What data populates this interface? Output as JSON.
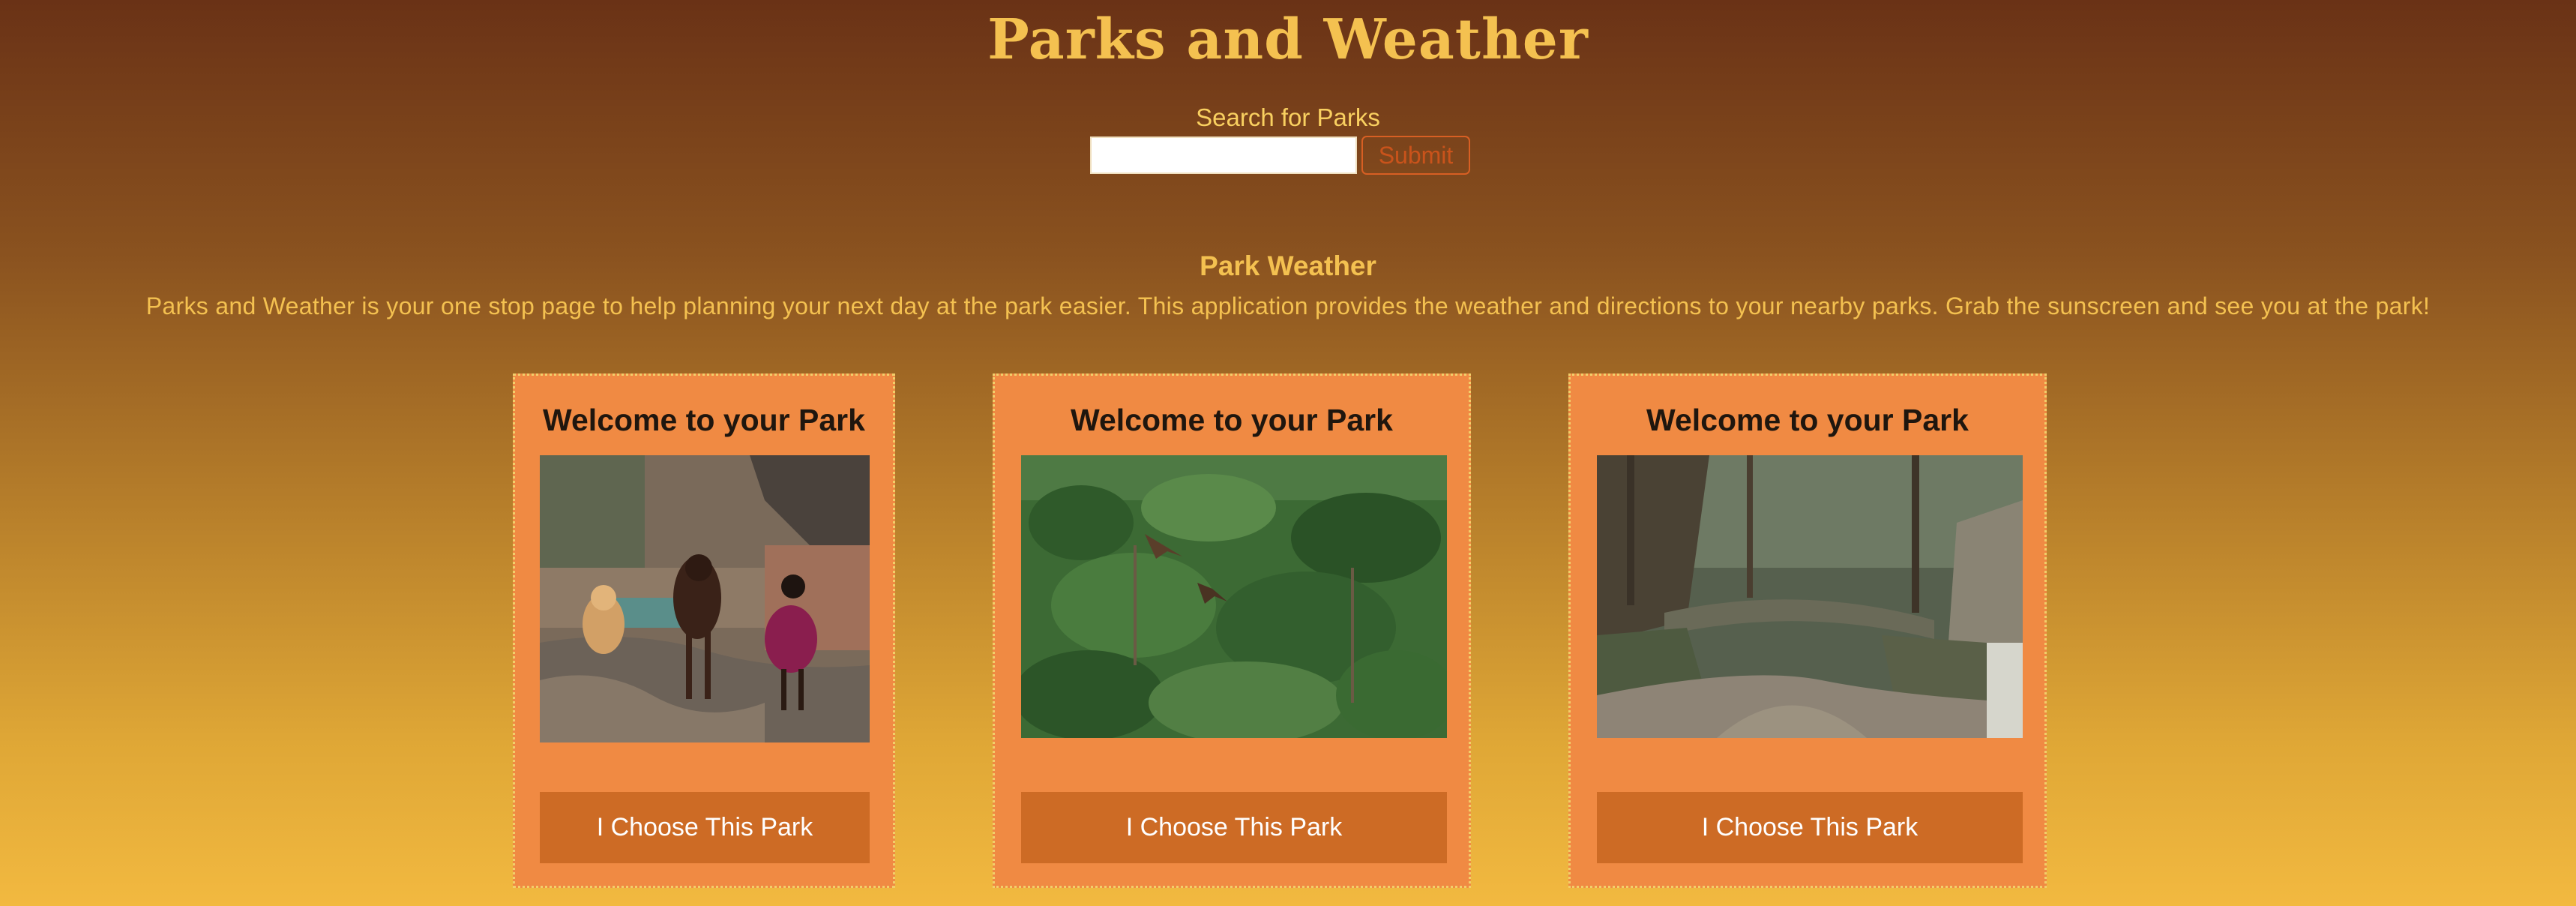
{
  "header": {
    "title": "Parks and Weather"
  },
  "search": {
    "label": "Search for Parks",
    "input_value": "",
    "placeholder": "",
    "submit_label": "Submit"
  },
  "about": {
    "heading": "Park Weather",
    "text": "Parks and Weather is your one stop page to help planning your next day at the park easier. This application provides the weather and directions to your nearby parks. Grab the sunscreen and see you at the park!"
  },
  "cards": [
    {
      "title": "Welcome to your Park",
      "image": "photo-three-dogs-on-rocky-trail",
      "button_label": "I Choose This Park"
    },
    {
      "title": "Welcome to your Park",
      "image": "photo-birds-over-forest-canopy",
      "button_label": "I Choose This Park"
    },
    {
      "title": "Welcome to your Park",
      "image": "photo-stone-bridge-in-gorge",
      "button_label": "I Choose This Park"
    }
  ],
  "colors": {
    "background_top": "#6a3216",
    "background_bottom": "#f2b940",
    "title_text": "#f4c150",
    "card_background": "#f08a43",
    "card_border": "#f2cf6a",
    "button_background": "#cd6b25",
    "submit_border": "#d85f23"
  }
}
